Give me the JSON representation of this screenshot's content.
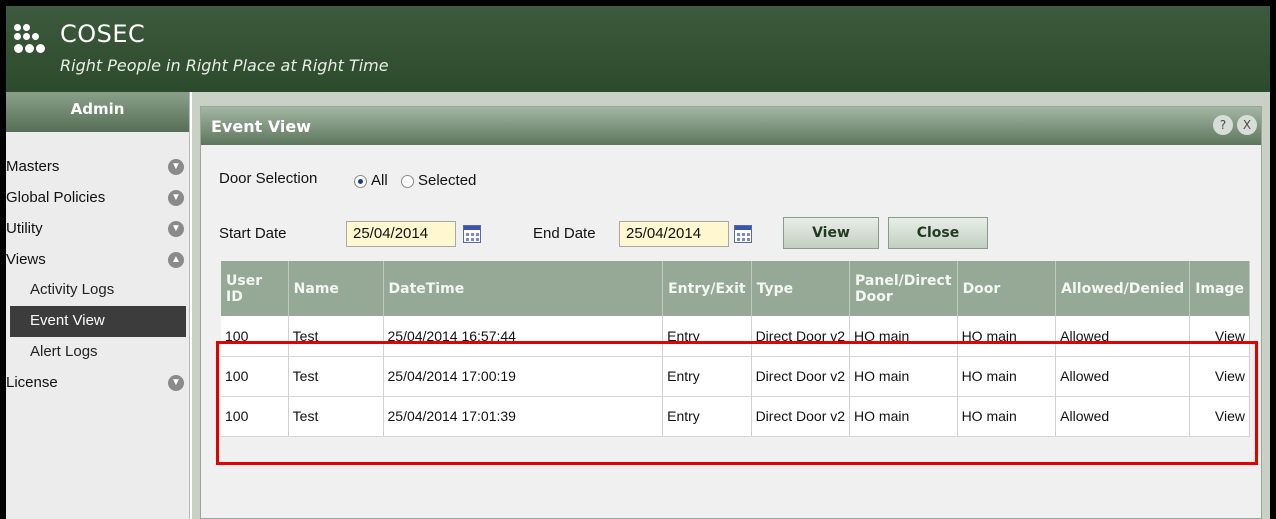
{
  "brand": {
    "title": "COSEC",
    "tagline": "Right People in Right Place at Right Time"
  },
  "sidebar": {
    "header": "Admin",
    "items": [
      {
        "label": "Masters",
        "icon": "chevron-down-icon"
      },
      {
        "label": "Global Policies",
        "icon": "chevron-down-icon"
      },
      {
        "label": "Utility",
        "icon": "chevron-down-icon"
      },
      {
        "label": "Views",
        "icon": "chevron-up-icon"
      },
      {
        "label": "License",
        "icon": "chevron-down-icon"
      }
    ],
    "subitems": [
      {
        "label": "Activity Logs",
        "active": false
      },
      {
        "label": "Event View",
        "active": true
      },
      {
        "label": "Alert Logs",
        "active": false
      }
    ]
  },
  "panel": {
    "title": "Event View",
    "help_label": "?",
    "close_label": "X"
  },
  "form": {
    "door_selection_label": "Door Selection",
    "radio_all_label": "All",
    "radio_selected_label": "Selected",
    "selected_option": "All",
    "start_date_label": "Start Date",
    "start_date_value": "25/04/2014",
    "end_date_label": "End Date",
    "end_date_value": "25/04/2014",
    "view_button": "View",
    "close_button": "Close"
  },
  "table": {
    "headers": [
      "User ID",
      "Name",
      "DateTime",
      "Entry/Exit",
      "Type",
      "Panel/Direct Door",
      "Door",
      "Allowed/Denied",
      "Image"
    ],
    "rows": [
      [
        "100",
        "Test",
        "25/04/2014 16:57:44",
        "Entry",
        "Direct Door v2",
        "HO main",
        "HO main",
        "Allowed",
        "View"
      ],
      [
        "100",
        "Test",
        "25/04/2014 17:00:19",
        "Entry",
        "Direct Door v2",
        "HO main",
        "HO main",
        "Allowed",
        "View"
      ],
      [
        "100",
        "Test",
        "25/04/2014 17:01:39",
        "Entry",
        "Direct Door v2",
        "HO main",
        "HO main",
        "Allowed",
        "View"
      ]
    ]
  },
  "colors": {
    "header_green": "#2c4a2c",
    "table_header": "#96a896",
    "highlight_red": "#e00000"
  }
}
